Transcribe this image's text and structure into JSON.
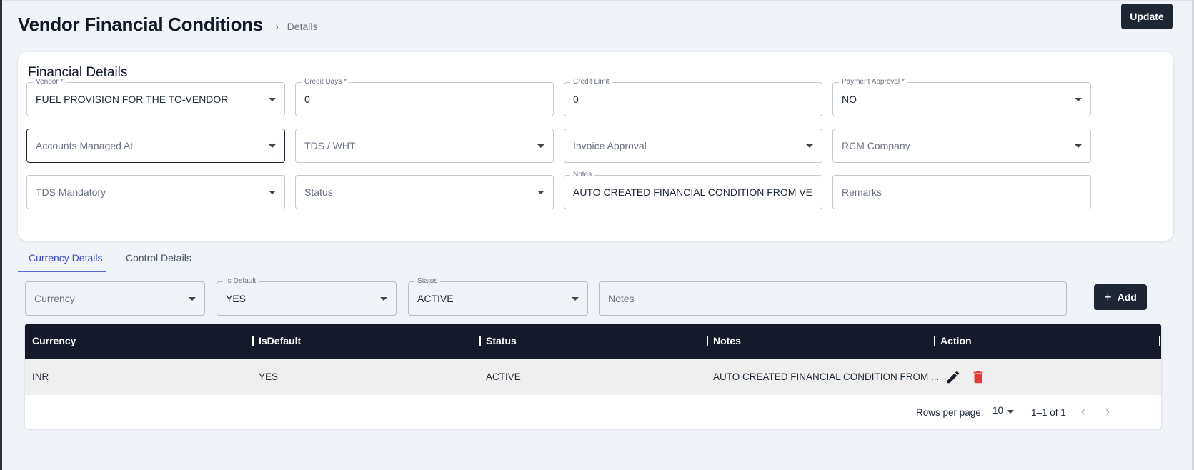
{
  "page": {
    "title": "Vendor Financial Conditions",
    "breadcrumb": "Details",
    "update_label": "Update"
  },
  "financial": {
    "title": "Financial Details",
    "vendor": {
      "label": "Vendor *",
      "value": "FUEL PROVISION FOR THE TO-VENDOR"
    },
    "credit_days": {
      "label": "Credit Days *",
      "value": "0"
    },
    "credit_limit": {
      "label": "Credit Limit",
      "value": "0"
    },
    "payment_approval": {
      "label": "Payment Approval *",
      "value": "NO"
    },
    "accounts_managed_at": {
      "placeholder": "Accounts Managed At"
    },
    "tds_wht": {
      "placeholder": "TDS / WHT"
    },
    "invoice_approval": {
      "placeholder": "Invoice Approval"
    },
    "rcm_company": {
      "placeholder": "RCM Company"
    },
    "tds_mandatory": {
      "placeholder": "TDS Mandatory"
    },
    "status": {
      "placeholder": "Status"
    },
    "notes": {
      "label": "Notes",
      "value": "AUTO CREATED FINANCIAL CONDITION FROM VENDOR MASTER"
    },
    "remarks": {
      "placeholder": "Remarks"
    }
  },
  "tabs": [
    {
      "label": "Currency Details",
      "active": true
    },
    {
      "label": "Control Details",
      "active": false
    }
  ],
  "currency_form": {
    "currency": {
      "placeholder": "Currency"
    },
    "is_default": {
      "label": "Is Default",
      "value": "YES"
    },
    "status": {
      "label": "Status",
      "value": "ACTIVE"
    },
    "notes": {
      "placeholder": "Notes"
    },
    "add_label": "Add"
  },
  "table": {
    "columns": [
      "Currency",
      "IsDefault",
      "Status",
      "Notes",
      "Action"
    ],
    "rows": [
      {
        "currency": "INR",
        "is_default": "YES",
        "status": "ACTIVE",
        "notes": "AUTO CREATED FINANCIAL CONDITION FROM ..."
      }
    ],
    "rows_per_page_label": "Rows per page:",
    "rows_per_page": "10",
    "range": "1–1 of 1"
  },
  "colors": {
    "accent": "#3b4bc8",
    "dark": "#1e2533",
    "table_header": "#141a29",
    "delete": "#e53935"
  }
}
